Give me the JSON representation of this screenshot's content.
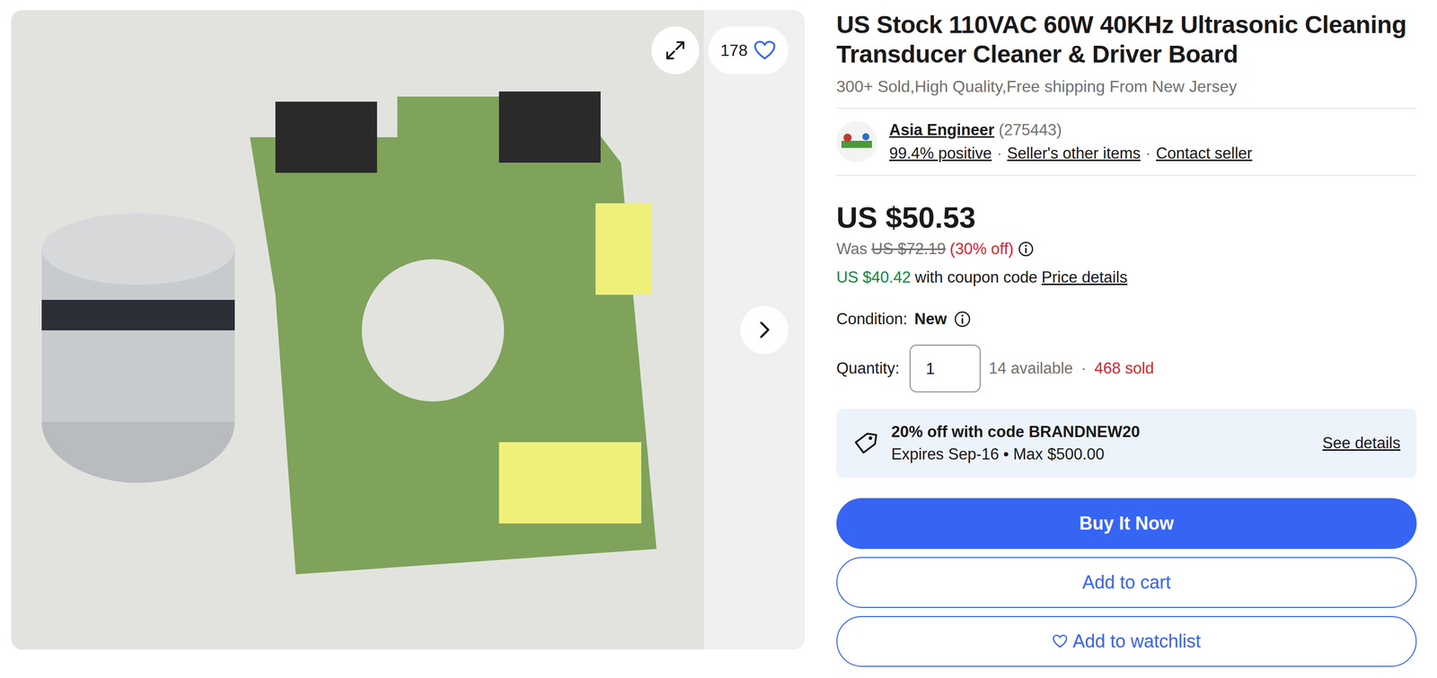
{
  "gallery": {
    "like_count": "178"
  },
  "title": "US Stock 110VAC 60W 40KHz Ultrasonic Cleaning Transducer Cleaner & Driver Board",
  "subtitle": "300+ Sold,High Quality,Free shipping From New Jersey",
  "seller": {
    "name": "Asia Engineer",
    "feedback_count": "(275443)",
    "line": [
      {
        "text": "99.4% positive",
        "kind": "link"
      },
      {
        "text": "·",
        "kind": "sep"
      },
      {
        "text": "Seller's other items",
        "kind": "link"
      },
      {
        "text": "·",
        "kind": "sep"
      },
      {
        "text": "Contact seller",
        "kind": "link"
      }
    ]
  },
  "price": {
    "current": "US $50.53",
    "was_label": "Was",
    "was_price": "US $72.19",
    "discount": "(30% off)",
    "coupon_price": "US $40.42",
    "coupon_text": "with coupon code",
    "details": "Price details"
  },
  "condition": {
    "label": "Condition:",
    "value": "New"
  },
  "quantity": {
    "label": "Quantity:",
    "value": "1",
    "available": "14 available",
    "separator": "·",
    "sold": "468 sold"
  },
  "promo": {
    "title": "20% off with code BRANDNEW20",
    "subtitle": "Expires Sep-16 • Max $500.00",
    "link": "See details"
  },
  "buttons": [
    {
      "label": "Buy It Now",
      "kind": "primary"
    },
    {
      "label": "Add to cart",
      "kind": "secondary"
    },
    {
      "label": "Add to watchlist",
      "kind": "watchlist"
    }
  ]
}
